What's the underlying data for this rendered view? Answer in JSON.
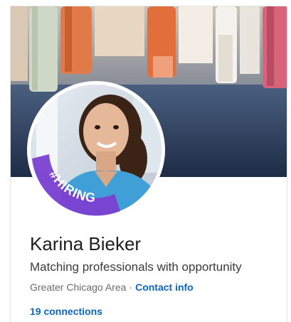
{
  "profile": {
    "name": "Karina Bieker",
    "headline": "Matching professionals with opportunity",
    "location": "Greater Chicago Area",
    "separator": "·",
    "contact_info_label": "Contact info",
    "connections_label": "19 connections",
    "hiring_badge": "#HIRING"
  },
  "colors": {
    "link": "#0a66c2",
    "hiring_ring": "#7b3fd1"
  }
}
